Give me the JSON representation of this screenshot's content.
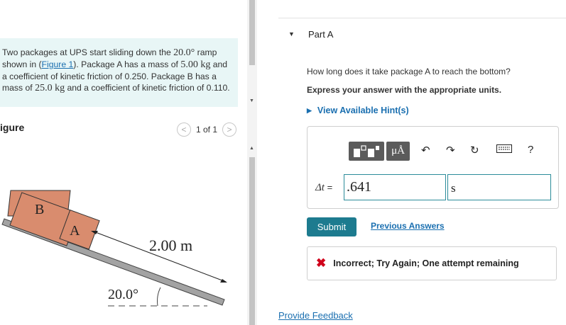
{
  "problem": {
    "text_1": "Two packages at UPS start sliding down the ",
    "angle": "20.0°",
    "text_2": " ramp shown in (",
    "figure_link": "Figure 1",
    "text_3": "). Package A has a mass of ",
    "mass_a": "5.00 kg",
    "text_4": " and a coefficient of kinetic friction of 0.250. Package B has a mass of ",
    "mass_b": "25.0 kg",
    "text_5": " and a coefficient of kinetic friction of 0.110."
  },
  "figure_panel": {
    "label": "igure",
    "pager_prev": "<",
    "pager_text": "1 of 1",
    "pager_next": ">",
    "box_b": "B",
    "box_a": "A",
    "length": "2.00 m",
    "angle": "20.0°"
  },
  "part": {
    "caret": "▼",
    "title": "Part A",
    "question": "How long does it take package A to reach the bottom?",
    "instruction": "Express your answer with the appropriate units.",
    "hint_caret": "▶",
    "hint_label": "View Available Hint(s)"
  },
  "toolbar": {
    "template_icon": "template-icon",
    "units_label": "μÅ",
    "undo_icon": "undo-icon",
    "redo_icon": "redo-icon",
    "reset_icon": "reset-icon",
    "keyboard_icon": "keyboard-icon",
    "help_label": "?"
  },
  "answer": {
    "var_label": "Δt",
    "equals": " = ",
    "value": ".641",
    "unit": "s"
  },
  "actions": {
    "submit": "Submit",
    "previous_answers": "Previous Answers",
    "feedback_icon": "✖",
    "feedback_text": "Incorrect; Try Again; One attempt remaining",
    "provide_feedback": "Provide Feedback"
  },
  "colors": {
    "accent": "#1d7b8f",
    "link": "#1a6fb0",
    "error": "#d0021b",
    "problem_bg": "#e8f6f6",
    "box_fill": "#d98c6e"
  }
}
